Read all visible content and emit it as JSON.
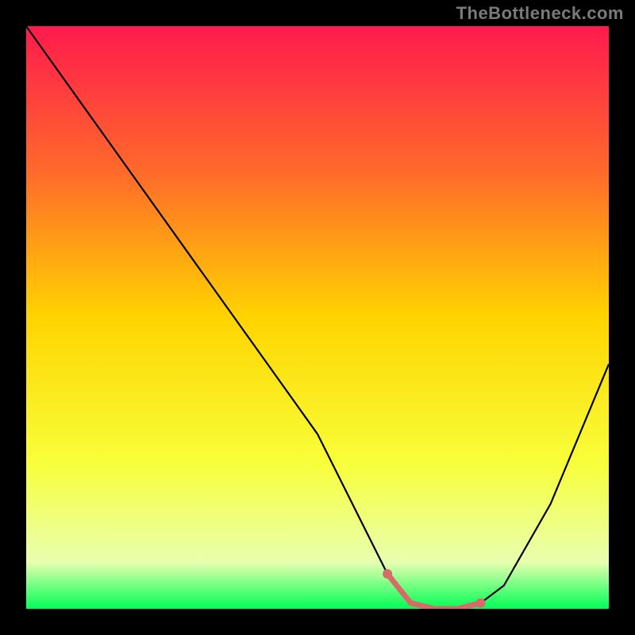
{
  "attribution": "TheBottleneck.com",
  "chart_data": {
    "type": "line",
    "title": "",
    "xlabel": "",
    "ylabel": "",
    "xlim": [
      0,
      100
    ],
    "ylim": [
      0,
      100
    ],
    "series": [
      {
        "name": "bottleneck-curve",
        "x": [
          0,
          10,
          20,
          30,
          40,
          50,
          58,
          62,
          66,
          70,
          74,
          78,
          82,
          90,
          100
        ],
        "y": [
          100,
          86,
          72,
          58,
          44,
          30,
          14,
          6,
          1,
          0,
          0,
          1,
          4,
          18,
          42
        ]
      }
    ],
    "highlight_segment": {
      "name": "optimal-range-markers",
      "x": [
        62,
        66,
        70,
        74,
        78
      ],
      "y": [
        6,
        1,
        0,
        0,
        1
      ]
    },
    "gradient_stops": [
      {
        "offset": 0,
        "color": "#ff1a4d"
      },
      {
        "offset": 25,
        "color": "#ff6a2a"
      },
      {
        "offset": 50,
        "color": "#ffd400"
      },
      {
        "offset": 75,
        "color": "#f8ff3a"
      },
      {
        "offset": 92,
        "color": "#e8ffb0"
      },
      {
        "offset": 100,
        "color": "#00ff55"
      }
    ]
  }
}
